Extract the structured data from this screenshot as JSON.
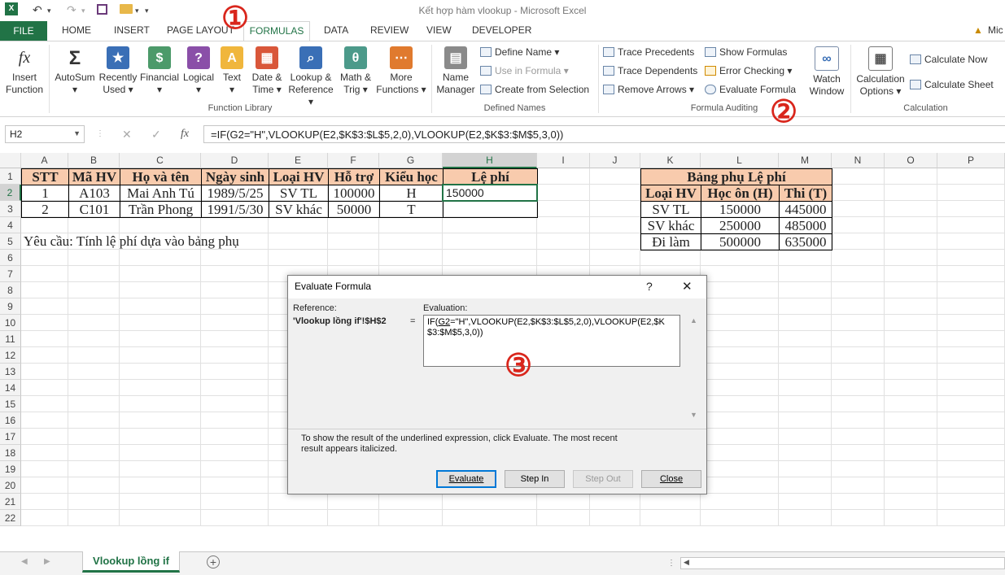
{
  "window": {
    "title": "Kết hợp hàm vlookup - Microsoft Excel"
  },
  "tabs": [
    "FILE",
    "HOME",
    "INSERT",
    "PAGE LAYOUT",
    "FORMULAS",
    "DATA",
    "REVIEW",
    "VIEW",
    "DEVELOPER"
  ],
  "account": "Mic",
  "ribbon": {
    "insert_function": [
      "Insert",
      "Function"
    ],
    "library": [
      {
        "l1": "AutoSum",
        "l2": "▾"
      },
      {
        "l1": "Recently",
        "l2": "Used ▾"
      },
      {
        "l1": "Financial",
        "l2": "▾"
      },
      {
        "l1": "Logical",
        "l2": "▾"
      },
      {
        "l1": "Text",
        "l2": "▾"
      },
      {
        "l1": "Date &",
        "l2": "Time ▾"
      },
      {
        "l1": "Lookup &",
        "l2": "Reference ▾"
      },
      {
        "l1": "Math &",
        "l2": "Trig ▾"
      },
      {
        "l1": "More",
        "l2": "Functions ▾"
      }
    ],
    "function_library_label": "Function Library",
    "name_manager": [
      "Name",
      "Manager"
    ],
    "define_name": "Define Name",
    "use_in_formula": "Use in Formula",
    "create_from_selection": "Create from Selection",
    "defined_names_label": "Defined Names",
    "trace_precedents": "Trace Precedents",
    "trace_dependents": "Trace Dependents",
    "remove_arrows": "Remove Arrows",
    "show_formulas": "Show Formulas",
    "error_checking": "Error Checking",
    "evaluate_formula": "Evaluate Formula",
    "formula_auditing_label": "Formula Auditing",
    "watch_window": [
      "Watch",
      "Window"
    ],
    "calc_options": [
      "Calculation",
      "Options ▾"
    ],
    "calculate_now": "Calculate Now",
    "calculate_sheet": "Calculate Sheet",
    "calculation_label": "Calculation"
  },
  "formula_bar": {
    "name_box": "H2",
    "formula": "=IF(G2=\"H\",VLOOKUP(E2,$K$3:$L$5,2,0),VLOOKUP(E2,$K$3:$M$5,3,0))"
  },
  "columns": [
    "A",
    "B",
    "C",
    "D",
    "E",
    "F",
    "G",
    "H",
    "I",
    "J",
    "K",
    "L",
    "M",
    "N",
    "O",
    "P"
  ],
  "rows": [
    "1",
    "2",
    "3",
    "4",
    "5",
    "6",
    "7",
    "8",
    "9",
    "10",
    "11",
    "12",
    "13",
    "14",
    "15",
    "16",
    "17",
    "18",
    "19",
    "20",
    "21",
    "22"
  ],
  "main_table": {
    "headers": [
      "STT",
      "Mã HV",
      "Họ và tên",
      "Ngày sinh",
      "Loại HV",
      "Hỗ trợ",
      "Kiểu học",
      "Lệ phí"
    ],
    "rows": [
      [
        "1",
        "A103",
        "Mai Anh Tú",
        "1989/5/25",
        "SV TL",
        "100000",
        "H",
        "150000"
      ],
      [
        "2",
        "C101",
        "Trần Phong",
        "1991/5/30",
        "SV khác",
        "50000",
        "T",
        ""
      ]
    ]
  },
  "requirement": "Yêu cầu: Tính lệ phí dựa vào bảng phụ",
  "aux_table": {
    "title": "Bảng phụ Lệ phí",
    "headers": [
      "Loại HV",
      "Học ôn (H)",
      "Thi (T)"
    ],
    "rows": [
      [
        "SV TL",
        "150000",
        "445000"
      ],
      [
        "SV khác",
        "250000",
        "485000"
      ],
      [
        "Đi làm",
        "500000",
        "635000"
      ]
    ]
  },
  "dialog": {
    "title": "Evaluate Formula",
    "help": "?",
    "close": "✕",
    "reference_label": "Reference:",
    "evaluation_label": "Evaluation:",
    "reference_value": "'Vlookup lồng if'!$H$2",
    "equals": "=",
    "eval_pre": "IF(",
    "eval_underlined": "G2",
    "eval_post": "=\"H\",VLOOKUP(E2,$K$3:$L$5,2,0),VLOOKUP(E2,$K$3:$M$5,3,0))",
    "hint_line1": "To show the result of the underlined expression, click Evaluate.  The most recent",
    "hint_line2": "result appears italicized.",
    "evaluate": "Evaluate",
    "step_in": "Step In",
    "step_out": "Step Out",
    "close_btn": "Close"
  },
  "sheet_tab": "Vlookup lồng if",
  "annotations": [
    "①",
    "②",
    "③"
  ],
  "colors": {
    "excel_green": "#217346",
    "header_fill": "#f8cbad",
    "annotation_red": "#d9261c"
  }
}
